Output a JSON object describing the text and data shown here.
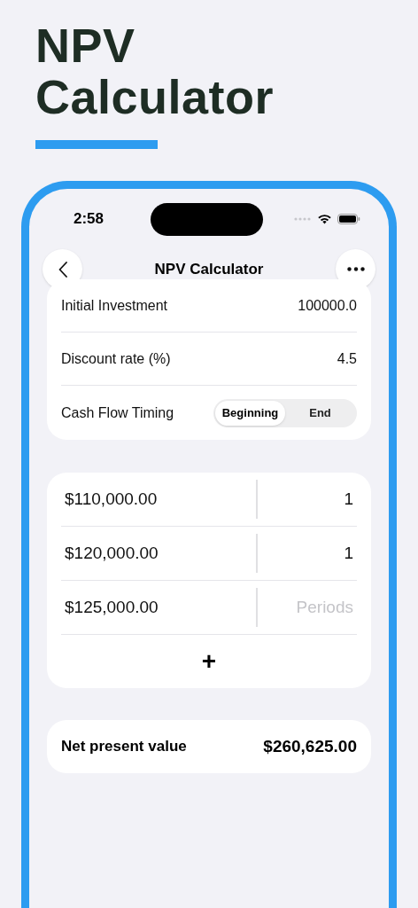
{
  "headline": "NPV Calculator",
  "status_bar": {
    "time": "2:58"
  },
  "nav": {
    "title": "NPV Calculator"
  },
  "settings": [
    {
      "label": "Initial Investment",
      "value": "100000.0"
    },
    {
      "label": "Discount rate (%)",
      "value": "4.5"
    }
  ],
  "timing": {
    "label": "Cash Flow Timing",
    "options": [
      {
        "label": "Beginning",
        "selected": true
      },
      {
        "label": "End",
        "selected": false
      }
    ]
  },
  "cash_flows": [
    {
      "amount": "$110,000.00",
      "periods": "1"
    },
    {
      "amount": "$120,000.00",
      "periods": "1"
    },
    {
      "amount": "$125,000.00",
      "placeholder": "Periods"
    }
  ],
  "add_button": "+",
  "result": {
    "label": "Net present value",
    "value": "$260,625.00"
  }
}
